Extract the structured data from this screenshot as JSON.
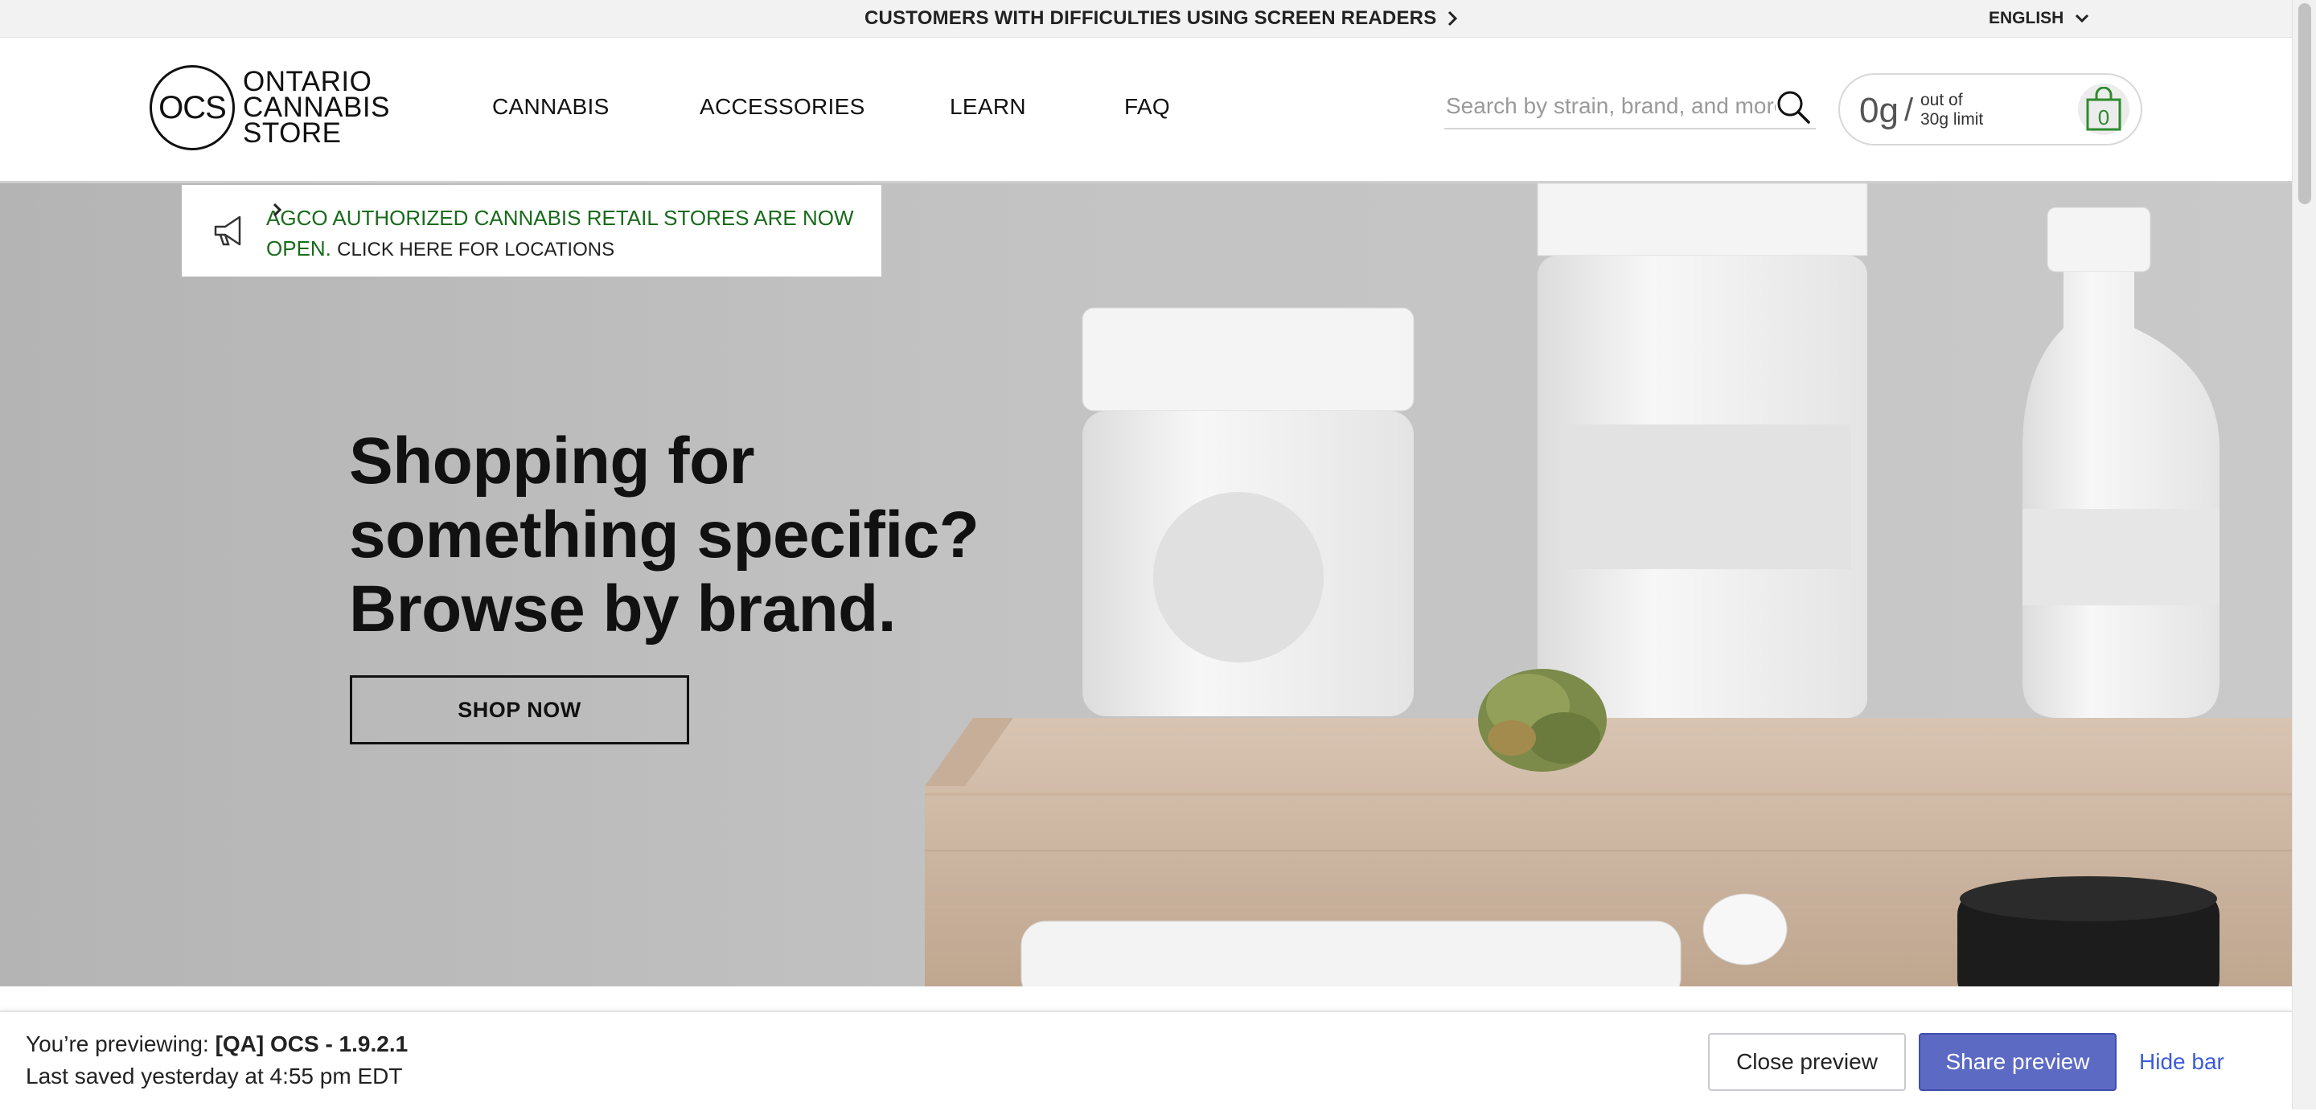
{
  "topbar": {
    "accessibility_link": "CUSTOMERS WITH DIFFICULTIES USING SCREEN READERS",
    "language": "ENGLISH"
  },
  "header": {
    "logo": {
      "mark": "OCS",
      "line1": "ONTARIO",
      "line2": "CANNABIS",
      "line3": "STORE"
    },
    "nav": [
      "CANNABIS",
      "ACCESSORIES",
      "LEARN",
      "FAQ"
    ],
    "search_placeholder": "Search by strain, brand, and more",
    "limit": {
      "amount": "0g",
      "separator": "/",
      "text_line1": "out of",
      "text_line2": "30g limit"
    },
    "cart_count": "0"
  },
  "hero": {
    "announcement_text": "AGCO AUTHORIZED CANNABIS RETAIL STORES ARE NOW OPEN.",
    "announcement_link": "CLICK HERE FOR LOCATIONS",
    "headline": "Shopping for something specific? Browse by brand.",
    "cta": "SHOP NOW"
  },
  "preview_bar": {
    "prefix": "You’re previewing:",
    "theme": "[QA] OCS - 1.9.2.1",
    "saved": "Last saved yesterday at 4:55 pm EDT",
    "close_label": "Close preview",
    "share_label": "Share preview",
    "hide_label": "Hide bar"
  },
  "colors": {
    "announcement_green": "#186b1b",
    "cart_green": "#2e8b2e",
    "share_button": "#5c6ac4",
    "hide_link": "#3b5bdb"
  }
}
